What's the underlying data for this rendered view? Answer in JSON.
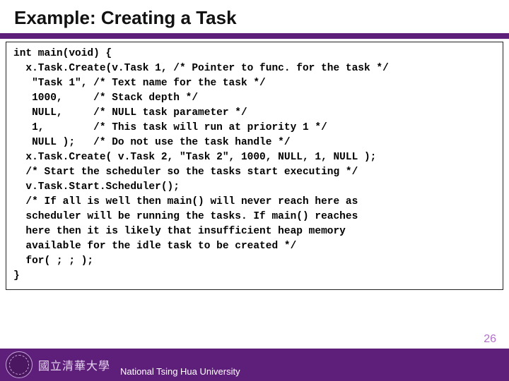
{
  "slide": {
    "title": "Example: Creating a Task",
    "code": "int main(void) {\n  x.Task.Create(v.Task 1, /* Pointer to func. for the task */\n   \"Task 1\", /* Text name for the task */\n   1000,     /* Stack depth */\n   NULL,     /* NULL task parameter */\n   1,        /* This task will run at priority 1 */\n   NULL );   /* Do not use the task handle */\n  x.Task.Create( v.Task 2, \"Task 2\", 1000, NULL, 1, NULL );\n  /* Start the scheduler so the tasks start executing */\n  v.Task.Start.Scheduler();\n  /* If all is well then main() will never reach here as\n  scheduler will be running the tasks. If main() reaches\n  here then it is likely that insufficient heap memory\n  available for the idle task to be created */\n  for( ; ; );\n}",
    "footer_cal": "國立清華大學",
    "footer_text": "National Tsing Hua University",
    "page_number": "26"
  }
}
